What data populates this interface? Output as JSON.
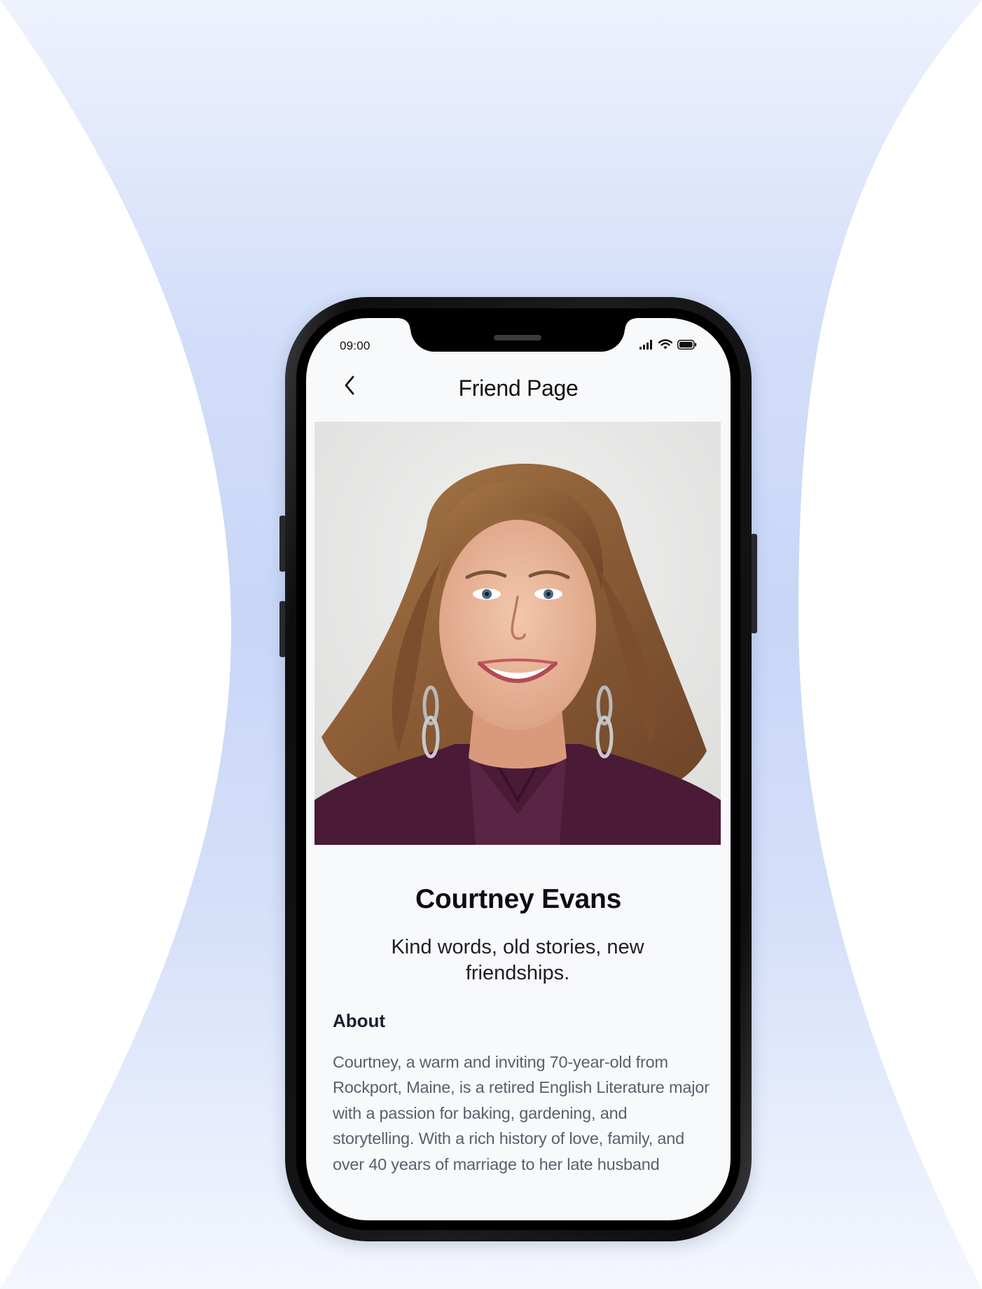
{
  "status_bar": {
    "time": "09:00",
    "icons": [
      "signal-bars-icon",
      "wifi-icon",
      "battery-icon"
    ]
  },
  "nav": {
    "back_icon": "chevron-left-icon",
    "title": "Friend Page"
  },
  "profile": {
    "photo": "portrait-photo",
    "name": "Courtney Evans",
    "tagline": "Kind words, old stories, new friendships.",
    "about_heading": "About",
    "about_text": "Courtney, a warm and inviting 70-year-old from Rockport, Maine, is a retired English Literature major with a passion for baking, gardening, and storytelling. With a rich history of love, family, and over 40 years of marriage to her late husband Richard, she cherishes meaningful"
  },
  "colors": {
    "background_glow": "#c8d6f7",
    "screen_background": "#f8f9fb",
    "title_text": "#0d0d12",
    "body_text": "#5b5f6c",
    "phone_frame": "#1c1c1e"
  }
}
